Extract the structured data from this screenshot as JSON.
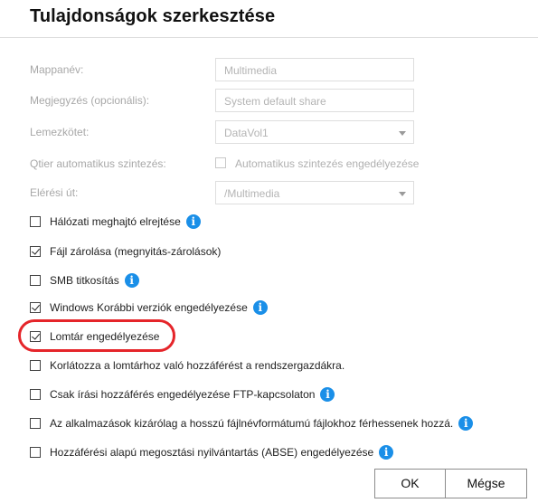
{
  "dialog": {
    "title": "Tulajdonságok szerkesztése"
  },
  "form": {
    "folder_name": {
      "label": "Mappanév:",
      "placeholder": "Multimedia"
    },
    "comment": {
      "label": "Megjegyzés (opcionális):",
      "placeholder": "System default share"
    },
    "volume": {
      "label": "Lemezkötet:",
      "value": "DataVol1"
    },
    "qtier": {
      "label": "Qtier automatikus szintezés:",
      "checkbox_label": "Automatikus szintezés engedélyezése",
      "checked": false
    },
    "path": {
      "label": "Elérési út:",
      "value": "/Multimedia"
    }
  },
  "options": [
    {
      "label": "Hálózati meghajtó elrejtése",
      "checked": false,
      "info": true,
      "info_icon": "info-icon"
    },
    {
      "label": "Fájl zárolása (megnyitás-zárolások)",
      "checked": true,
      "info": false
    },
    {
      "label": "SMB titkosítás",
      "checked": false,
      "info": true,
      "info_icon": "info-icon"
    },
    {
      "label": "Windows Korábbi verziók engedélyezése",
      "checked": true,
      "info": true,
      "info_icon": "info-icon"
    },
    {
      "label": "Lomtár engedélyezése",
      "checked": true,
      "info": false,
      "highlighted": true
    },
    {
      "label": "Korlátozza a lomtárhoz való hozzáférést a rendszergazdákra.",
      "checked": false,
      "info": false
    },
    {
      "label": "Csak írási hozzáférés engedélyezése FTP-kapcsolaton",
      "checked": false,
      "info": true,
      "info_icon": "info-icon"
    },
    {
      "label": "Az alkalmazások kizárólag a hosszú fájlnévformátumú fájlokhoz férhessenek hozzá.",
      "checked": false,
      "info": true,
      "info_icon": "info-icon"
    },
    {
      "label": "Hozzáférési alapú megosztási nyilvántartás (ABSE) engedélyezése",
      "checked": false,
      "info": true,
      "info_icon": "info-icon"
    }
  ],
  "icons": {
    "info_glyph": "i"
  },
  "buttons": {
    "ok": "OK",
    "cancel": "Mégse"
  },
  "colors": {
    "info": "#1a8fe8",
    "highlight": "#e5252a"
  }
}
